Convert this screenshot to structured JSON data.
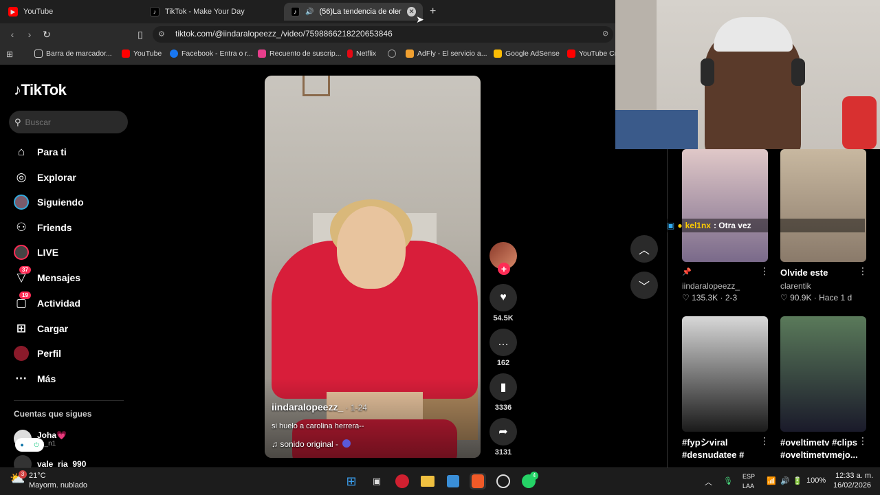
{
  "browser": {
    "tabs": [
      {
        "label": "YouTube",
        "icon": "youtube-icon",
        "color": "#ff0000"
      },
      {
        "label": "TikTok - Make Your Day",
        "icon": "tiktok-icon",
        "color": "#000000"
      },
      {
        "label": "(56)La tendencia de oler a Ca",
        "icon": "tiktok-icon",
        "color": "#000000"
      }
    ],
    "url": "tiktok.com/@iindaralopeezz_/video/7598866218220653846",
    "bookmarks": [
      {
        "label": "Barra de marcador...",
        "icon": "folder-icon",
        "color": "#cccccc"
      },
      {
        "label": "YouTube",
        "icon": "youtube-icon",
        "color": "#ff0000"
      },
      {
        "label": "Facebook - Entra o r...",
        "icon": "facebook-icon",
        "color": "#1877f2"
      },
      {
        "label": "Recuento de suscrip...",
        "icon": "counter-icon",
        "color": "#e83e8c"
      },
      {
        "label": "Netflix",
        "icon": "netflix-icon",
        "color": "#e50914"
      },
      {
        "label": "",
        "icon": "globe-icon",
        "color": "#999999"
      },
      {
        "label": "AdFly - El servicio a...",
        "icon": "adfly-icon",
        "color": "#f0a030"
      },
      {
        "label": "Google AdSense",
        "icon": "adsense-icon",
        "color": "#fbbc04"
      },
      {
        "label": "YouTube Cr",
        "icon": "youtube-icon",
        "color": "#ff0000"
      }
    ]
  },
  "sidebar": {
    "logo": "TikTok",
    "search_placeholder": "Buscar",
    "items": [
      {
        "label": "Para ti",
        "icon": "home-icon",
        "glyph": "⌂",
        "badge": ""
      },
      {
        "label": "Explorar",
        "icon": "compass-icon",
        "glyph": "◎",
        "badge": ""
      },
      {
        "label": "Siguiendo",
        "icon": "following-avatar-icon",
        "glyph": "●",
        "badge": ""
      },
      {
        "label": "Friends",
        "icon": "friends-icon",
        "glyph": "⚇",
        "badge": ""
      },
      {
        "label": "LIVE",
        "icon": "live-icon",
        "glyph": "◉",
        "badge": ""
      },
      {
        "label": "Mensajes",
        "icon": "messages-icon",
        "glyph": "▽",
        "badge": "37"
      },
      {
        "label": "Actividad",
        "icon": "activity-icon",
        "glyph": "▢",
        "badge": "19"
      },
      {
        "label": "Cargar",
        "icon": "upload-icon",
        "glyph": "⊞",
        "badge": ""
      },
      {
        "label": "Perfil",
        "icon": "profile-icon",
        "glyph": "●",
        "badge": ""
      },
      {
        "label": "Más",
        "icon": "more-icon",
        "glyph": "···",
        "badge": ""
      }
    ],
    "following_title": "Cuentas que sigues",
    "following": [
      {
        "name": "Joha💗",
        "handle": "rls_n1"
      },
      {
        "name": "vale_ria_990",
        "handle": ""
      }
    ]
  },
  "video": {
    "username": "iindaralopeezz_",
    "date": " · 1-24",
    "caption": "si huelo a carolina herrera--",
    "sound": "♫  sonido original -"
  },
  "actions": {
    "likes": "54.5K",
    "comments": "162",
    "saves": "3336",
    "shares": "3131"
  },
  "chat_overlay": {
    "user": "kel1nx",
    "message": ": Otra vez"
  },
  "grid": [
    {
      "desc": "",
      "user": "iindaralopeezz_",
      "likes": "135.3K",
      "date": "2-3",
      "thumb_color": "#c9a8a8"
    },
    {
      "desc": "Olvide este",
      "user": "clarentik",
      "likes": "90.9K",
      "date": "Hace 1 d",
      "thumb_color": "#b09070"
    },
    {
      "desc": "#fypシviral #desnudatee #",
      "user": "",
      "likes": "",
      "date": "",
      "thumb_color": "#555555"
    },
    {
      "desc": "#oveltimetv #clips #oveltimetvmejo...",
      "user": "",
      "likes": "",
      "date": "",
      "thumb_color": "#4a6a4a"
    }
  ],
  "taskbar": {
    "weather_temp": "21°C",
    "weather_desc": "Mayorm. nublado",
    "weather_badge": "3",
    "lang_top": "ESP",
    "lang_bottom": "LAA",
    "battery": "100%",
    "time": "12:33 a. m.",
    "date": "16/02/2026",
    "whatsapp_badge": "4"
  }
}
